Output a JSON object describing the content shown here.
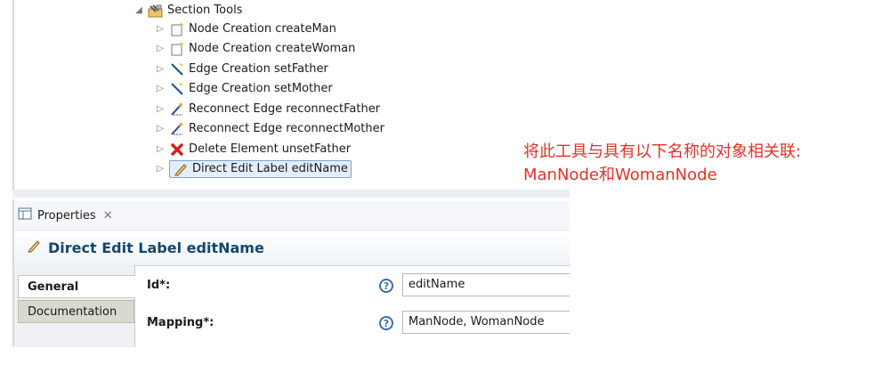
{
  "tree": {
    "section": {
      "label": "Section Tools",
      "icon": "section-tools-icon"
    },
    "items": [
      {
        "label": "Node Creation createMan",
        "icon": "node-creation-icon"
      },
      {
        "label": "Node Creation createWoman",
        "icon": "node-creation-icon"
      },
      {
        "label": "Edge Creation setFather",
        "icon": "edge-creation-icon"
      },
      {
        "label": "Edge Creation setMother",
        "icon": "edge-creation-icon"
      },
      {
        "label": "Reconnect Edge reconnectFather",
        "icon": "reconnect-edge-icon"
      },
      {
        "label": "Reconnect Edge reconnectMother",
        "icon": "reconnect-edge-icon"
      },
      {
        "label": "Delete Element unsetFather",
        "icon": "delete-icon"
      },
      {
        "label": "Direct Edit Label editName",
        "icon": "pencil-icon",
        "selected": true
      }
    ]
  },
  "properties": {
    "tab_label": "Properties",
    "title": "Direct Edit Label editName",
    "side_tabs": [
      "General",
      "Documentation"
    ],
    "fields": [
      {
        "label": "Id*:",
        "value": "editName"
      },
      {
        "label": "Mapping*:",
        "value": "ManNode, WomanNode"
      }
    ]
  },
  "annotation": {
    "line1": "将此工具与具有以下名称的对象相关联:",
    "line2": "ManNode和WomanNode",
    "color": "#e0322a"
  }
}
